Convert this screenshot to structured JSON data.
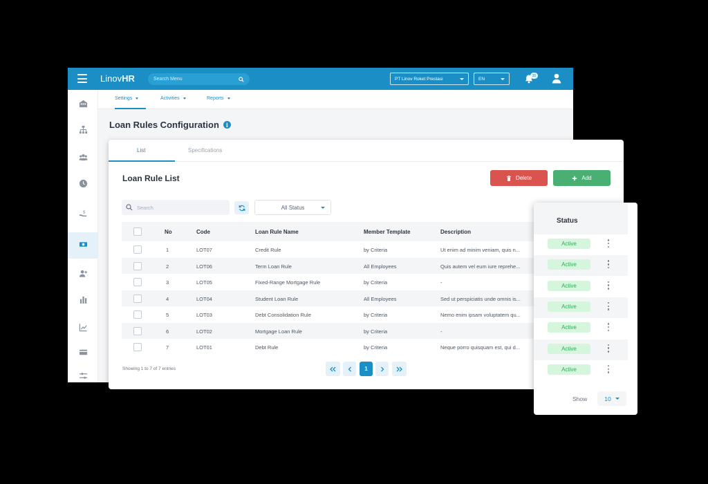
{
  "app": {
    "logo_prefix": "Linov",
    "logo_suffix": "HR",
    "search_placeholder": "Search Menu",
    "company": "PT Linov Roket Prestasi",
    "language": "EN",
    "notification_count": "30"
  },
  "subnav": {
    "items": [
      {
        "label": "Settings"
      },
      {
        "label": "Activities"
      },
      {
        "label": "Reports"
      }
    ]
  },
  "page": {
    "title": "Loan Rules Configuration"
  },
  "card": {
    "tabs": [
      {
        "label": "List"
      },
      {
        "label": "Specifications"
      }
    ],
    "list_title": "Loan Rule List",
    "delete_label": "Delete",
    "add_label": "Add",
    "search_placeholder": "Search",
    "status_filter": "All Status"
  },
  "table": {
    "headers": [
      "No",
      "Code",
      "Loan Rule Name",
      "Member Template",
      "Description"
    ],
    "rows": [
      {
        "no": "1",
        "code": "LOT07",
        "name": "Credit Rule",
        "template": "by Criteria",
        "desc": "Ut enim ad minim veniam, quis n..."
      },
      {
        "no": "2",
        "code": "LOT06",
        "name": "Term Loan Rule",
        "template": "All Employees",
        "desc": "Quis autem vel eum iure reprehe..."
      },
      {
        "no": "3",
        "code": "LOT05",
        "name": "Fixed-Range Mortgage Rule",
        "template": "by Criteria",
        "desc": "-"
      },
      {
        "no": "4",
        "code": "LOT04",
        "name": "Student Loan Rule",
        "template": "All Employees",
        "desc": "Sed ut perspiciatis unde omnis is..."
      },
      {
        "no": "5",
        "code": "LOT03",
        "name": "Debt Consolidation Rule",
        "template": "by Criteria",
        "desc": "Nemo enim ipsam voluptatem qu..."
      },
      {
        "no": "6",
        "code": "LOT02",
        "name": "Mortgage Loan Rule",
        "template": "by Criteria",
        "desc": "-"
      },
      {
        "no": "7",
        "code": "LOT01",
        "name": "Debt Rule",
        "template": "by Criteria",
        "desc": "Neque porro quisquam est, qui d..."
      }
    ]
  },
  "footer": {
    "info": "Showing 1 to 7 of 7 entries",
    "current_page": "1"
  },
  "status_panel": {
    "header": "Status",
    "values": [
      "Active",
      "Active",
      "Active",
      "Active",
      "Active",
      "Active",
      "Active"
    ],
    "show_label": "Show",
    "show_value": "10"
  },
  "colors": {
    "primary": "#1b8fc5",
    "danger": "#d9534f",
    "success": "#4aaf72",
    "active_badge_bg": "#d6f5dd",
    "active_badge_text": "#36a85a"
  }
}
